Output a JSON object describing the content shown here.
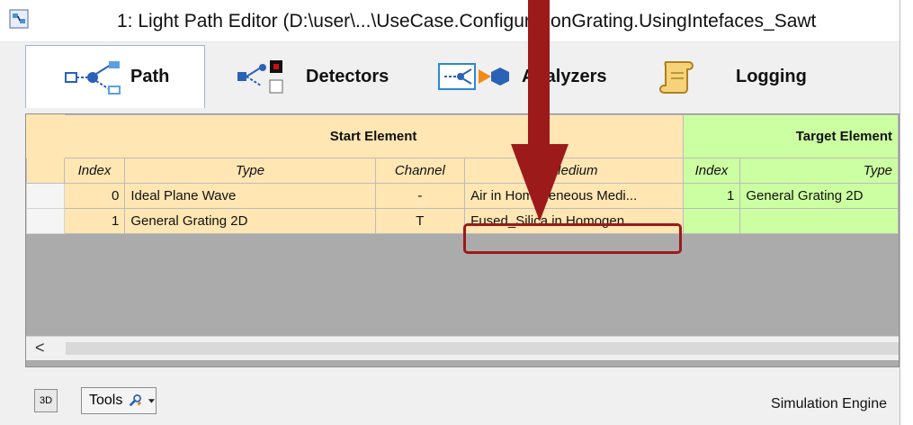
{
  "window": {
    "title": "1: Light Path Editor (D:\\user\\...\\UseCase.ConfigurationGrating.UsingIntefaces_Sawt"
  },
  "tabs": [
    {
      "label": "Path",
      "icon": "path-icon",
      "active": true
    },
    {
      "label": "Detectors",
      "icon": "detectors-icon"
    },
    {
      "label": "Analyzers",
      "icon": "analyzers-icon"
    },
    {
      "label": "Logging",
      "icon": "scroll-icon"
    }
  ],
  "grid": {
    "group_headers": {
      "start": "Start Element",
      "target": "Target Element"
    },
    "columns": {
      "index": "Index",
      "type": "Type",
      "channel": "Channel",
      "medium": "Medium",
      "target_index": "Index",
      "target_type": "Type"
    },
    "rows": [
      {
        "index": "0",
        "type": "Ideal Plane Wave",
        "channel": "-",
        "medium": "Air in Homogeneous Medi...",
        "target_index": "1",
        "target_type": "General Grating 2D"
      },
      {
        "index": "1",
        "type": "General Grating 2D",
        "channel": "T",
        "medium": "Fused_Silica in Homogen...",
        "target_index": "",
        "target_type": ""
      }
    ],
    "scroll_left_label": "<"
  },
  "statusbar": {
    "view3d_label": "3D",
    "tools_label": "Tools",
    "engine_label": "Simulation Engine"
  },
  "colors": {
    "start_group": "#ffe6b3",
    "target_group": "#ccffa1",
    "annotation": "#9c1a1a"
  }
}
